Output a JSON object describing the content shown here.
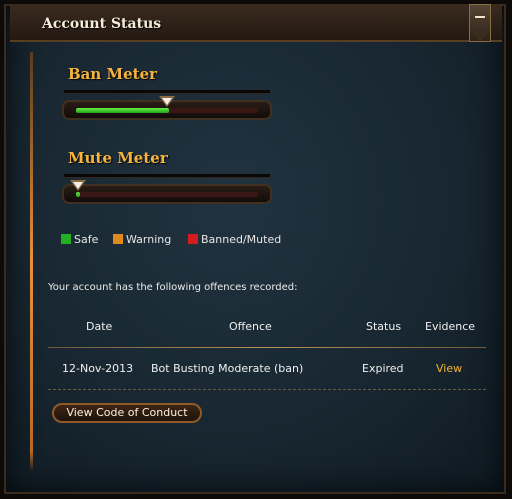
{
  "header": {
    "title": "Account Status"
  },
  "ban_meter": {
    "title": "Ban Meter",
    "level": 0.5
  },
  "mute_meter": {
    "title": "Mute Meter",
    "level": 0.02
  },
  "legend": [
    {
      "label": "Safe",
      "color": "#22b020"
    },
    {
      "label": "Warning",
      "color": "#e08a1e"
    },
    {
      "label": "Banned/Muted",
      "color": "#d41c1c"
    }
  ],
  "offences": {
    "intro": "Your account has the following offences recorded:",
    "columns": [
      "Date",
      "Offence",
      "Status",
      "Evidence"
    ],
    "rows": [
      {
        "date": "12-Nov-2013",
        "offence": "Bot Busting Moderate (ban)",
        "status": "Expired",
        "evidence": "View"
      }
    ]
  },
  "code_of_conduct_button": "View Code of Conduct",
  "colors": {
    "accent": "#f4b338",
    "panel": "#1a2a34"
  },
  "icons": {
    "collapse": "minus-icon"
  }
}
